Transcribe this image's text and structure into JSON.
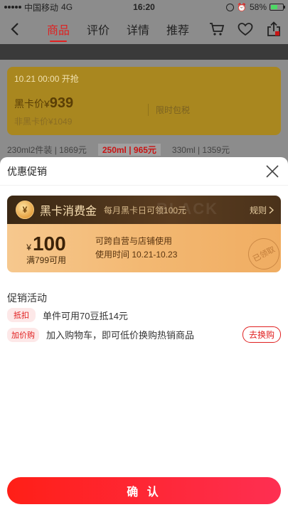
{
  "status_bar": {
    "carrier": "中国移动",
    "network": "4G",
    "time": "16:20",
    "battery": "58%",
    "battery_level": 0.58
  },
  "nav": {
    "tabs": [
      {
        "label": "商品",
        "active": true
      },
      {
        "label": "评价",
        "active": false
      },
      {
        "label": "详情",
        "active": false
      },
      {
        "label": "推荐",
        "active": false
      }
    ]
  },
  "background_page": {
    "promo_time": "10.21 00:00 开抢",
    "black_card_price_label": "黑卡价¥",
    "black_card_price": "939",
    "non_member_price": "非黑卡价¥1049",
    "free_shipping": "限时包税",
    "specs": [
      "230ml2件装 | 1869元",
      "250ml | 965元",
      "330ml | 1359元"
    ]
  },
  "sheet": {
    "title": "优惠促销",
    "coupon": {
      "name": "黑卡消费金",
      "tip": "每月黑卡日可领100元",
      "rules_label": "规则",
      "watermark": "BLACK",
      "currency": "¥",
      "amount": "100",
      "threshold": "满799可用",
      "desc_line1": "可跨自营与店铺使用",
      "desc_line2": "使用时间 10.21-10.23",
      "stamp": "已领取"
    },
    "promotions_title": "促销活动",
    "promotions": [
      {
        "tag": "抵扣",
        "text": "单件可用70豆抵14元"
      },
      {
        "tag": "加价购",
        "text": "加入购物车，即可低价换购热销商品",
        "action": "去换购"
      }
    ],
    "confirm_label": "确 认"
  },
  "colors": {
    "accent": "#e02020",
    "coupon_dark": "#3a2814",
    "coupon_gold": "#f3b872"
  }
}
